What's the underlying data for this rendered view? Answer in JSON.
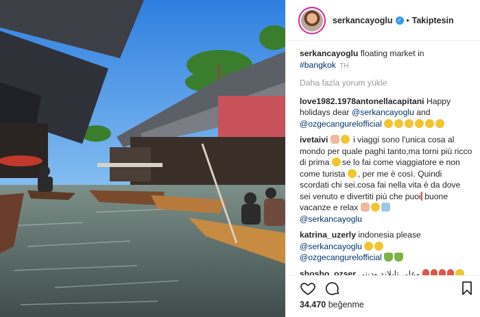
{
  "header": {
    "username": "serkancayoglu",
    "verified_glyph": "✓",
    "separator": "•",
    "follow_status": "Takiptesin"
  },
  "caption": {
    "username": "serkancayoglu",
    "text": "floating market in",
    "hashtag": "#bangkok",
    "time": "TH"
  },
  "load_more": "Daha fazla yorum yükle",
  "comments": [
    {
      "username": "love1982.1978antonellacapitani",
      "text": "Happy holidays dear",
      "mention1": "@serkancayoglu",
      "and": "and",
      "mention2": "@ozgecangurelofficial"
    },
    {
      "username": "ivetaivi",
      "text_a": "i viaggi sono l'unica cosa al mondo per quale paghi tanto,ma torni più ricco di prima",
      "text_b": "se lo fai come viaggiatore e non come turista",
      "text_c": ", per me è così. Quindi scordati chi sei.cosa fai nella vita è da dove sei venuto e divertiti più che puoi",
      "text_d": "buone vacanze e relax",
      "mention": "@serkancayoglu"
    },
    {
      "username": "katrina_uzerly",
      "text": "indonesia please",
      "mention1": "@serkancayoglu",
      "mention2": "@ozgecangurelofficial"
    },
    {
      "username": "shosho_ozser",
      "text": "وعلي تايلاند وديني"
    }
  ],
  "icons": {
    "like": "heart-icon",
    "comment": "comment-icon",
    "save": "bookmark-icon"
  },
  "likes": {
    "count": "34.470",
    "label": "beğenme"
  },
  "colors": {
    "link": "#003569",
    "verified": "#3897f0",
    "muted": "#999999",
    "text": "#262626"
  }
}
